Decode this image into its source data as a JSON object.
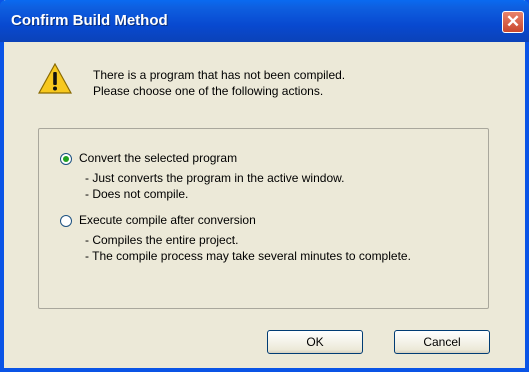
{
  "window": {
    "title": "Confirm Build Method"
  },
  "icons": {
    "close": "close-icon",
    "warning": "warning-icon"
  },
  "message": {
    "line1": "There is a program that has not been compiled.",
    "line2": "Please choose one of the following actions."
  },
  "options": [
    {
      "label": "Convert the selected program",
      "checked": true,
      "desc": [
        "- Just converts the program in the active window.",
        "- Does not compile."
      ]
    },
    {
      "label": "Execute compile after conversion",
      "checked": false,
      "desc": [
        "- Compiles the entire project.",
        "- The compile process may take several minutes to complete."
      ]
    }
  ],
  "buttons": {
    "ok": "OK",
    "cancel": "Cancel"
  },
  "colors": {
    "title_bar": "#0a54e6",
    "dialog_bg": "#ece9d8",
    "close_button": "#d45237",
    "radio_selected": "#21a121"
  }
}
